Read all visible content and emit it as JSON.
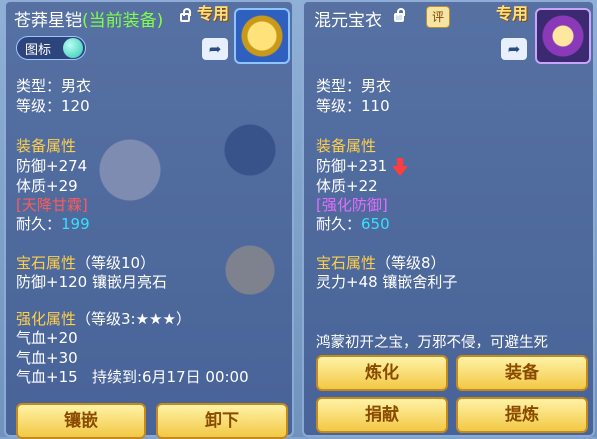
{
  "left": {
    "title": "苍莽星铠",
    "status": "(当前装备)",
    "special_label": "专用",
    "badge_label": "图标",
    "type_line": "类型：男衣",
    "level_line": "等级：120",
    "attr_heading": "装备属性",
    "attr_lines": [
      "防御+274",
      "体质+29"
    ],
    "tag": "[天降甘霖]",
    "durability_label": "耐久：",
    "durability_value": "199",
    "gem_heading": "宝石属性",
    "gem_level": "（等级10）",
    "gem_line": "防御+120 镶嵌月亮石",
    "enhance_heading": "强化属性",
    "enhance_level": "（等级3:★★★）",
    "enhance_lines": [
      "气血+20",
      "气血+30",
      "气血+15   持续到:6月17日 00:00"
    ],
    "buttons": {
      "inlay": "镶嵌",
      "unequip": "卸下"
    }
  },
  "right": {
    "title": "混元宝衣",
    "special_label": "专用",
    "review_label": "评",
    "type_line": "类型：男衣",
    "level_line": "等级：110",
    "attr_heading": "装备属性",
    "attr_lines": [
      "防御+231",
      "体质+22"
    ],
    "tag": "[强化防御]",
    "durability_label": "耐久：",
    "durability_value": "650",
    "gem_heading": "宝石属性",
    "gem_level": "（等级8）",
    "gem_line": "灵力+48 镶嵌舍利子",
    "description": "鸿蒙初开之宝，万邪不侵，可避生死",
    "buttons": {
      "refine": "炼化",
      "equip": "装备",
      "donate": "捐献",
      "extract": "提炼"
    }
  },
  "colors": {
    "heading": "#ffcf4a",
    "durability": "#36e0ff",
    "tag_left": "#ff5a5a",
    "tag_right": "#e36cff",
    "current": "#7fff4a"
  }
}
